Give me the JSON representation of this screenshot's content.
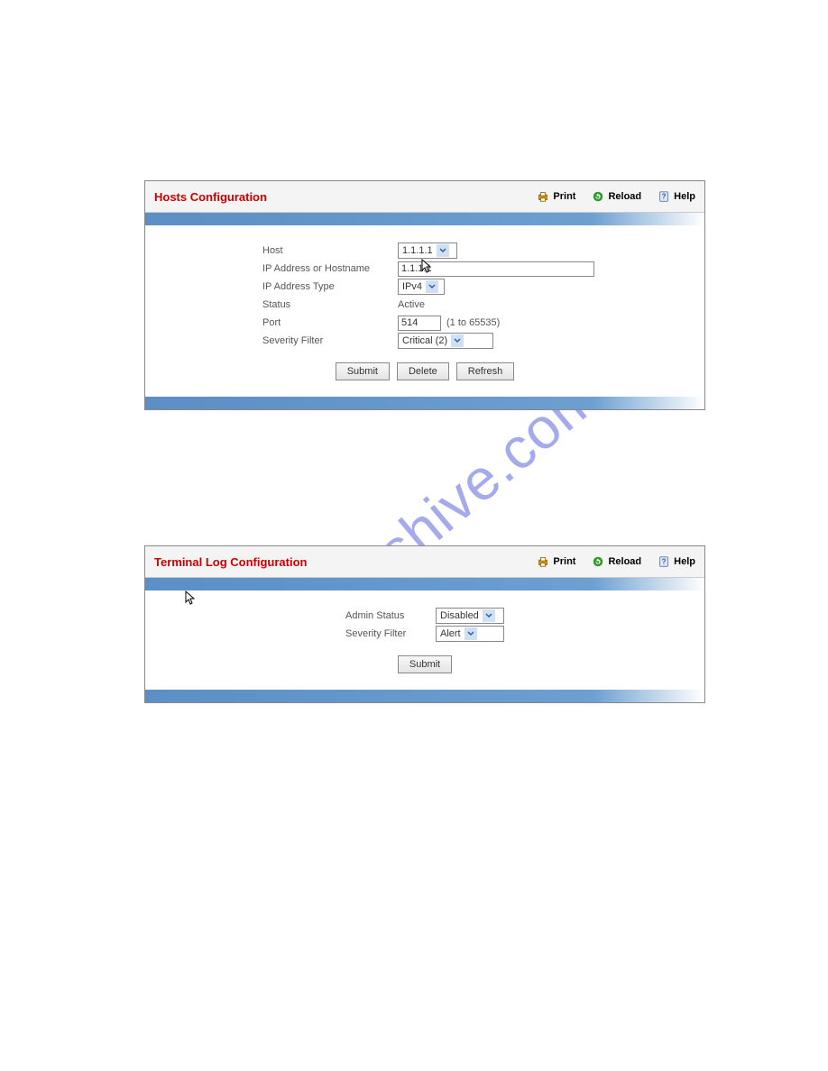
{
  "watermark": "manualshive.com",
  "toolbar": {
    "print": "Print",
    "reload": "Reload",
    "help": "Help"
  },
  "panel1": {
    "title": "Hosts Configuration",
    "fields": {
      "host_label": "Host",
      "host_value": "1.1.1.1",
      "ip_label": "IP Address or Hostname",
      "ip_value": "1.1.1.1",
      "iptype_label": "IP Address Type",
      "iptype_value": "IPv4",
      "status_label": "Status",
      "status_value": "Active",
      "port_label": "Port",
      "port_value": "514",
      "port_hint": "(1 to 65535)",
      "sev_label": "Severity Filter",
      "sev_value": "Critical (2)"
    },
    "buttons": {
      "submit": "Submit",
      "delete": "Delete",
      "refresh": "Refresh"
    }
  },
  "panel2": {
    "title": "Terminal Log Configuration",
    "fields": {
      "admin_label": "Admin Status",
      "admin_value": "Disabled",
      "sev_label": "Severity Filter",
      "sev_value": "Alert"
    },
    "buttons": {
      "submit": "Submit"
    }
  }
}
